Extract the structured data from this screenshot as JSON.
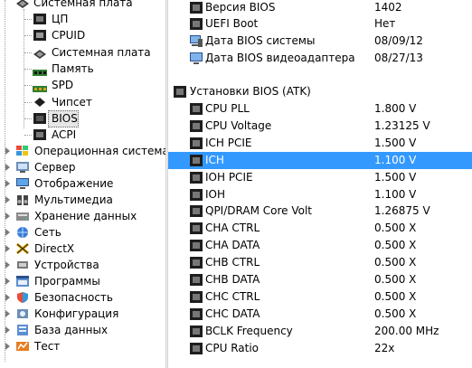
{
  "tree": {
    "items": [
      {
        "label": "Системная плата",
        "icon": "motherboard-icon",
        "level": 0
      },
      {
        "label": "ЦП",
        "icon": "cpu-icon",
        "level": 1
      },
      {
        "label": "CPUID",
        "icon": "cpuid-icon",
        "level": 1
      },
      {
        "label": "Системная плата",
        "icon": "motherboard-icon",
        "level": 1
      },
      {
        "label": "Память",
        "icon": "memory-icon",
        "level": 1
      },
      {
        "label": "SPD",
        "icon": "spd-icon",
        "level": 1
      },
      {
        "label": "Чипсет",
        "icon": "chipset-icon",
        "level": 1
      },
      {
        "label": "BIOS",
        "icon": "bios-icon",
        "level": 1
      },
      {
        "label": "ACPI",
        "icon": "acpi-icon",
        "level": 1
      },
      {
        "label": "Операционная система",
        "icon": "windows-icon",
        "level": 0
      },
      {
        "label": "Сервер",
        "icon": "server-icon",
        "level": 0
      },
      {
        "label": "Отображение",
        "icon": "display-icon",
        "level": 0
      },
      {
        "label": "Мультимедиа",
        "icon": "multimedia-icon",
        "level": 0
      },
      {
        "label": "Хранение данных",
        "icon": "storage-icon",
        "level": 0
      },
      {
        "label": "Сеть",
        "icon": "network-icon",
        "level": 0
      },
      {
        "label": "DirectX",
        "icon": "directx-icon",
        "level": 0
      },
      {
        "label": "Устройства",
        "icon": "devices-icon",
        "level": 0
      },
      {
        "label": "Программы",
        "icon": "programs-icon",
        "level": 0
      },
      {
        "label": "Безопасность",
        "icon": "security-icon",
        "level": 0
      },
      {
        "label": "Конфигурация",
        "icon": "config-icon",
        "level": 0
      },
      {
        "label": "База данных",
        "icon": "database-icon",
        "level": 0
      },
      {
        "label": "Тест",
        "icon": "test-icon",
        "level": 0
      }
    ]
  },
  "list": {
    "top_rows": [
      {
        "field": "Версия BIOS",
        "value": "1402",
        "icon": "chip-icon"
      },
      {
        "field": "UEFI Boot",
        "value": "Нет",
        "icon": "chip-icon"
      },
      {
        "field": "Дата BIOS системы",
        "value": "08/09/12",
        "icon": "computer-icon"
      },
      {
        "field": "Дата BIOS видеоадаптера",
        "value": "08/27/13",
        "icon": "monitor-icon"
      }
    ],
    "group_title": "Установки BIOS (ATK)",
    "group_rows": [
      {
        "field": "CPU PLL",
        "value": "1.800 V"
      },
      {
        "field": "CPU Voltage",
        "value": "1.23125 V"
      },
      {
        "field": "ICH PCIE",
        "value": "1.500 V"
      },
      {
        "field": "ICH",
        "value": "1.100 V"
      },
      {
        "field": "IOH PCIE",
        "value": "1.500 V"
      },
      {
        "field": "IOH",
        "value": "1.100 V"
      },
      {
        "field": "QPI/DRAM Core Volt",
        "value": "1.26875 V"
      },
      {
        "field": "CHA CTRL",
        "value": "0.500 X"
      },
      {
        "field": "CHA DATA",
        "value": "0.500 X"
      },
      {
        "field": "CHB CTRL",
        "value": "0.500 X"
      },
      {
        "field": "CHB DATA",
        "value": "0.500 X"
      },
      {
        "field": "CHC CTRL",
        "value": "0.500 X"
      },
      {
        "field": "CHC DATA",
        "value": "0.500 X"
      },
      {
        "field": "BCLK Frequency",
        "value": "200.00 MHz"
      },
      {
        "field": "CPU Ratio",
        "value": "22x"
      }
    ],
    "selected_field": "ICH"
  },
  "colors": {
    "selection": "#3399ff",
    "tree_selection": "#e6e6e6"
  }
}
